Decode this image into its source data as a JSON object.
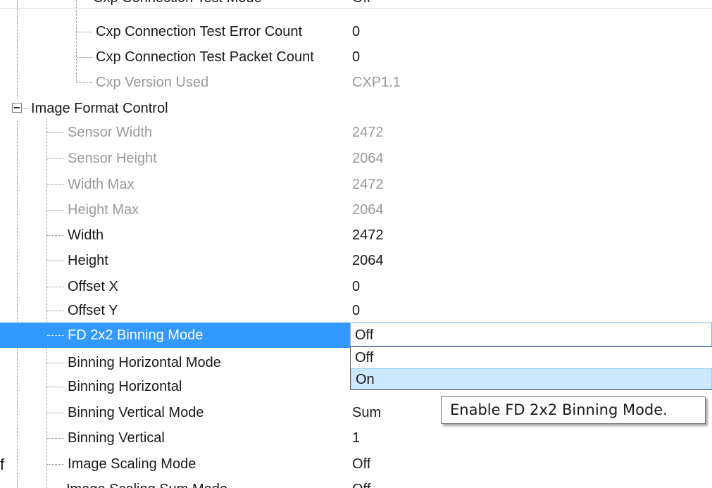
{
  "partial_top_row": {
    "label": "Cxp Connection Test Mode",
    "value": "Off"
  },
  "cxp_children": [
    {
      "label": "Cxp Connection Test Error Count",
      "value": "0",
      "disabled": false
    },
    {
      "label": "Cxp Connection Test Packet Count",
      "value": "0",
      "disabled": false
    },
    {
      "label": "Cxp Version Used",
      "value": "CXP1.1",
      "disabled": true
    }
  ],
  "category": {
    "label": "Image Format Control",
    "expanded": true
  },
  "features": [
    {
      "label": "Sensor Width",
      "value": "2472",
      "disabled": true
    },
    {
      "label": "Sensor Height",
      "value": "2064",
      "disabled": true
    },
    {
      "label": "Width Max",
      "value": "2472",
      "disabled": true
    },
    {
      "label": "Height Max",
      "value": "2064",
      "disabled": true
    },
    {
      "label": "Width",
      "value": "2472",
      "disabled": false
    },
    {
      "label": "Height",
      "value": "2064",
      "disabled": false
    },
    {
      "label": "Offset X",
      "value": "0",
      "disabled": false
    },
    {
      "label": "Offset Y",
      "value": "0",
      "disabled": false
    },
    {
      "label": "FD 2x2 Binning Mode",
      "value": "",
      "disabled": false,
      "selected": true
    },
    {
      "label": "Binning Horizontal Mode",
      "value": "",
      "disabled": false
    },
    {
      "label": "Binning Horizontal",
      "value": "",
      "disabled": false
    },
    {
      "label": "Binning Vertical Mode",
      "value": "Sum",
      "disabled": false
    },
    {
      "label": "Binning Vertical",
      "value": "1",
      "disabled": false
    },
    {
      "label": "Image Scaling Mode",
      "value": "Off",
      "disabled": false
    }
  ],
  "partial_bottom_row": {
    "label": "Image Scaling Sum Mode",
    "value": "Off"
  },
  "combo": {
    "value": "Off",
    "options": [
      "Off",
      "On"
    ],
    "highlighted_option": "On"
  },
  "tooltip": {
    "text": "Enable FD 2x2 Binning Mode."
  },
  "stray_text": "f",
  "colors": {
    "selection": "#3399ff",
    "disabled_text": "#9a9a9a",
    "dropdown_hover": "#cce8ff",
    "combo_border": "#7eb4ea"
  },
  "icons": {
    "expander": "minus-box-icon"
  }
}
